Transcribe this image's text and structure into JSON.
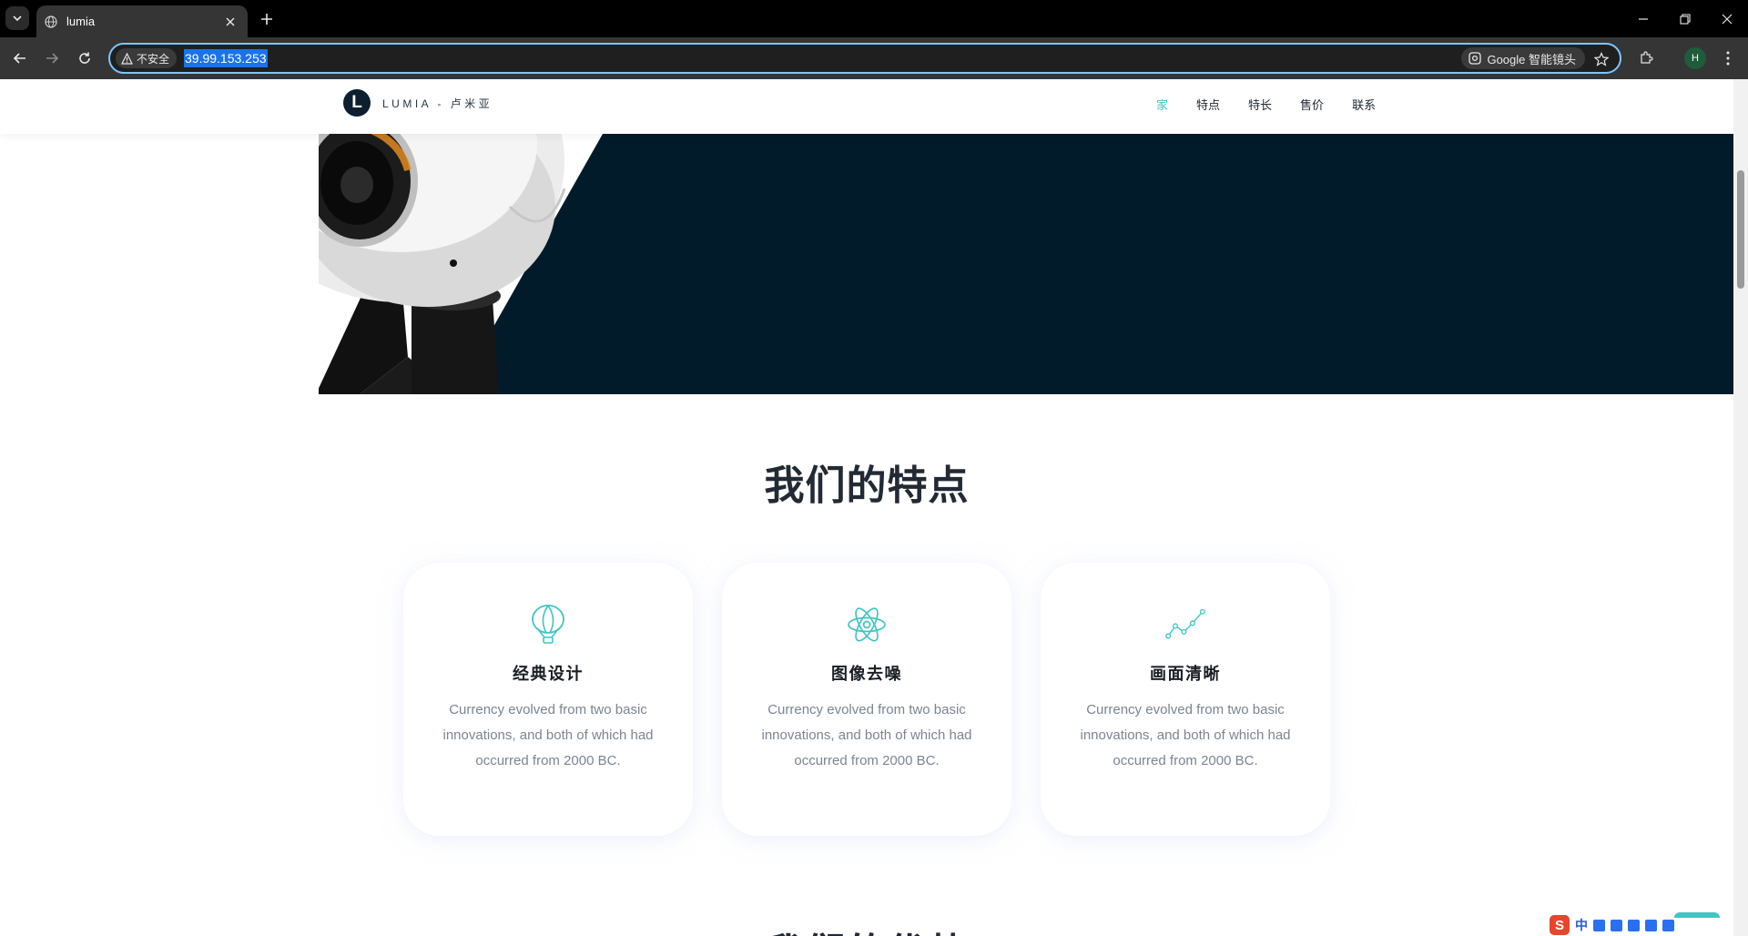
{
  "browser": {
    "tab_title": "lumia",
    "security_label": "不安全",
    "url": "39.99.153.253",
    "lens_label": "Google 智能镜头",
    "profile_initial": "H"
  },
  "site": {
    "logo_letter": "L",
    "logo_text": "LUMIA - 卢米亚",
    "nav": [
      {
        "label": "家",
        "active": true
      },
      {
        "label": "特点",
        "active": false
      },
      {
        "label": "特长",
        "active": false
      },
      {
        "label": "售价",
        "active": false
      },
      {
        "label": "联系",
        "active": false
      }
    ]
  },
  "features": {
    "title": "我们的特点",
    "cards": [
      {
        "icon": "balloon-icon",
        "title": "经典设计",
        "text": "Currency evolved from two basic innovations, and both of which had occurred from 2000 BC."
      },
      {
        "icon": "atom-icon",
        "title": "图像去噪",
        "text": "Currency evolved from two basic innovations, and both of which had occurred from 2000 BC."
      },
      {
        "icon": "line-chart-icon",
        "title": "画面清晰",
        "text": "Currency evolved from two basic innovations, and both of which had occurred from 2000 BC."
      }
    ]
  },
  "next_section": {
    "title": "我们的优势"
  },
  "ime": {
    "mode": "中"
  },
  "colors": {
    "accent": "#3ec6c2",
    "hero_dark": "#021b2b",
    "heading": "#222a35",
    "body_text": "#7b8591"
  }
}
